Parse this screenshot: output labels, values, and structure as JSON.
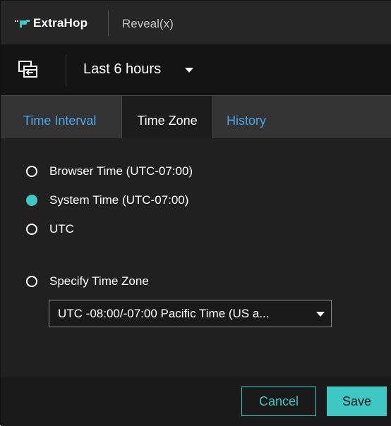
{
  "header": {
    "brand_name": "ExtraHop",
    "product_name": "Reveal(x)"
  },
  "time_selector": {
    "label": "Last 6 hours"
  },
  "tabs": [
    {
      "label": "Time Interval",
      "active": false
    },
    {
      "label": "Time Zone",
      "active": true
    },
    {
      "label": "History",
      "active": false
    }
  ],
  "time_zone": {
    "options": [
      {
        "label": "Browser Time (UTC-07:00)",
        "selected": false
      },
      {
        "label": "System Time (UTC-07:00)",
        "selected": true
      },
      {
        "label": "UTC",
        "selected": false
      },
      {
        "label": "Specify Time Zone",
        "selected": false
      }
    ],
    "specify_select_value": "UTC -08:00/-07:00 Pacific Time (US a..."
  },
  "actions": {
    "cancel_label": "Cancel",
    "save_label": "Save"
  },
  "colors": {
    "accent": "#3fc7c3",
    "tab_link": "#4ba5e6",
    "background": "#202020"
  }
}
